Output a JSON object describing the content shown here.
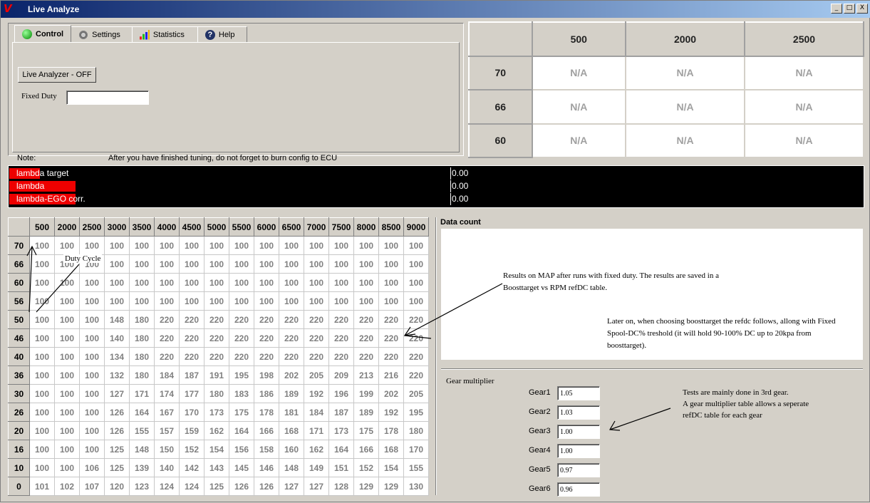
{
  "window": {
    "title": "Live Analyze",
    "logo": "V",
    "minimize": "_",
    "maximize": "□",
    "close": "X"
  },
  "tabs": [
    {
      "label": "Control",
      "icon": "green-circle-icon"
    },
    {
      "label": "Settings",
      "icon": "gear-icon"
    },
    {
      "label": "Statistics",
      "icon": "bar-chart-icon"
    },
    {
      "label": "Help",
      "icon": "help-icon"
    }
  ],
  "control": {
    "live_button": "Live Analyzer - OFF",
    "fixed_duty_label": "Fixed Duty",
    "fixed_duty_value": "",
    "note_label": "Note:",
    "note_text": "After you have finished tuning, do not forget to burn config to ECU"
  },
  "top_table": {
    "columns": [
      "500",
      "2000",
      "2500"
    ],
    "rows": [
      {
        "label": "70",
        "values": [
          "N/A",
          "N/A",
          "N/A"
        ]
      },
      {
        "label": "66",
        "values": [
          "N/A",
          "N/A",
          "N/A"
        ]
      },
      {
        "label": "60",
        "values": [
          "N/A",
          "N/A",
          "N/A"
        ]
      }
    ]
  },
  "gauges": [
    {
      "label": "lambda target",
      "value": "0.00",
      "fill": 0.07
    },
    {
      "label": "lambda",
      "value": "0.00",
      "fill": 0.15
    },
    {
      "label": "lambda-EGO corr.",
      "value": "0.00",
      "fill": 0.15
    }
  ],
  "duty_table": {
    "columns": [
      "500",
      "2000",
      "2500",
      "3000",
      "3500",
      "4000",
      "4500",
      "5000",
      "5500",
      "6000",
      "6500",
      "7000",
      "7500",
      "8000",
      "8500",
      "9000"
    ],
    "rows": [
      {
        "label": "70",
        "values": [
          100,
          100,
          100,
          100,
          100,
          100,
          100,
          100,
          100,
          100,
          100,
          100,
          100,
          100,
          100,
          100
        ]
      },
      {
        "label": "66",
        "values": [
          100,
          100,
          100,
          100,
          100,
          100,
          100,
          100,
          100,
          100,
          100,
          100,
          100,
          100,
          100,
          100
        ]
      },
      {
        "label": "60",
        "values": [
          100,
          100,
          100,
          100,
          100,
          100,
          100,
          100,
          100,
          100,
          100,
          100,
          100,
          100,
          100,
          100
        ]
      },
      {
        "label": "56",
        "values": [
          100,
          100,
          100,
          100,
          100,
          100,
          100,
          100,
          100,
          100,
          100,
          100,
          100,
          100,
          100,
          100
        ]
      },
      {
        "label": "50",
        "values": [
          100,
          100,
          100,
          148,
          180,
          220,
          220,
          220,
          220,
          220,
          220,
          220,
          220,
          220,
          220,
          220
        ]
      },
      {
        "label": "46",
        "values": [
          100,
          100,
          100,
          140,
          180,
          220,
          220,
          220,
          220,
          220,
          220,
          220,
          220,
          220,
          220,
          220
        ]
      },
      {
        "label": "40",
        "values": [
          100,
          100,
          100,
          134,
          180,
          220,
          220,
          220,
          220,
          220,
          220,
          220,
          220,
          220,
          220,
          220
        ]
      },
      {
        "label": "36",
        "values": [
          100,
          100,
          100,
          132,
          180,
          184,
          187,
          191,
          195,
          198,
          202,
          205,
          209,
          213,
          216,
          220
        ]
      },
      {
        "label": "30",
        "values": [
          100,
          100,
          100,
          127,
          171,
          174,
          177,
          180,
          183,
          186,
          189,
          192,
          196,
          199,
          202,
          205
        ]
      },
      {
        "label": "26",
        "values": [
          100,
          100,
          100,
          126,
          164,
          167,
          170,
          173,
          175,
          178,
          181,
          184,
          187,
          189,
          192,
          195
        ]
      },
      {
        "label": "20",
        "values": [
          100,
          100,
          100,
          126,
          155,
          157,
          159,
          162,
          164,
          166,
          168,
          171,
          173,
          175,
          178,
          180
        ]
      },
      {
        "label": "16",
        "values": [
          100,
          100,
          100,
          125,
          148,
          150,
          152,
          154,
          156,
          158,
          160,
          162,
          164,
          166,
          168,
          170
        ]
      },
      {
        "label": "10",
        "values": [
          100,
          100,
          106,
          125,
          139,
          140,
          142,
          143,
          145,
          146,
          148,
          149,
          151,
          152,
          154,
          155
        ]
      },
      {
        "label": "0",
        "values": [
          101,
          102,
          107,
          120,
          123,
          124,
          124,
          125,
          126,
          126,
          127,
          127,
          128,
          129,
          129,
          130
        ]
      }
    ]
  },
  "annotations": {
    "duty_cycle": "Duty Cycle",
    "data_count": "Data count",
    "results_line1": "Results on MAP after runs with fixed duty. The results are saved in a",
    "results_line2": "Boosttarget vs RPM refDC table.",
    "later_line1": "Later on, when choosing boosttarget the refdc follows, allong with Fixed",
    "later_line2": "Spool-DC% treshold (it will hold 90-100% DC up to 20kpa from",
    "later_line3": "boosttarget).",
    "tests_line1": "Tests are mainly done in 3rd gear.",
    "tests_line2": "A gear multiplier table allows a seperate",
    "tests_line3": "refDC table for each gear"
  },
  "gear": {
    "title": "Gear multiplier",
    "items": [
      {
        "label": "Gear1",
        "value": "1.05"
      },
      {
        "label": "Gear2",
        "value": "1.03"
      },
      {
        "label": "Gear3",
        "value": "1.00"
      },
      {
        "label": "Gear4",
        "value": "1.00"
      },
      {
        "label": "Gear5",
        "value": "0.97"
      },
      {
        "label": "Gear6",
        "value": "0.96"
      }
    ]
  }
}
